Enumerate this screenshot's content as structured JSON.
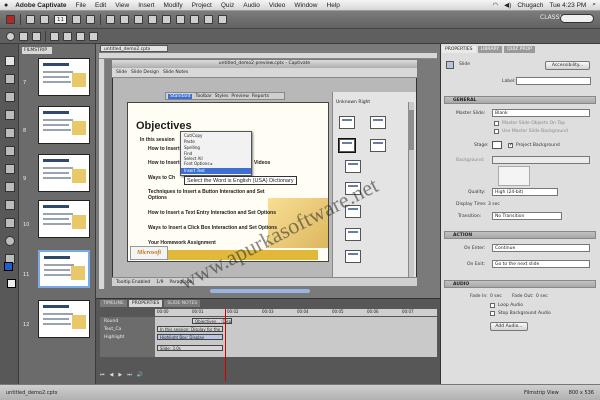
{
  "menubar": {
    "apple": "",
    "app_name": "Adobe Captivate",
    "items": [
      "File",
      "Edit",
      "View",
      "Insert",
      "Modify",
      "Project",
      "Quiz",
      "Audio",
      "Video",
      "Window",
      "Help"
    ],
    "user": "Chugach",
    "clock": "Tue 4:23 PM"
  },
  "toolbar": {
    "slide_number": "11",
    "workspace": "CLASSIC ▾"
  },
  "filmstrip": {
    "tab": "FILMSTRIP",
    "slide_numbers": [
      "7",
      "8",
      "9",
      "10",
      "11",
      "12"
    ],
    "selected_index": 4
  },
  "document": {
    "tab": "untitled_demo2.cptx",
    "inner_title": "untitled_demo2 preview.cptx - Captivate",
    "inner_toolbar": [
      "Slide",
      "Slide Design",
      "Slide Notes"
    ],
    "inner_tabs": [
      "Standard",
      "Toolbar",
      "Styles",
      "Preview",
      "Reports"
    ],
    "right_title": "Unknown Right",
    "slide": {
      "title": "Objectives",
      "lines": [
        "In this session",
        "How to Insert",
        "How to Insert",
        "Ways to Ch",
        "Techniques to Insert a Button Interaction and Set",
        "Options",
        "How to Insert a Text Entry Interaction and Set Options",
        "Ways to Insert a Click Box Interaction and Set Options",
        "Your Homework Assignment"
      ],
      "line_suffix": "Videos",
      "logo": "Microsoft"
    },
    "context_menu": [
      "Cut/Copy",
      "Paste",
      "Spelling",
      "Find",
      "Select All",
      "Font Options ▸",
      "Insert Text"
    ],
    "tooltip": "Select the Word is English (USA) Dictionary",
    "inner_status": [
      "Tooltip Enabled",
      "1/9",
      "Paragraph"
    ],
    "doc_status": [
      "Prev",
      "Next"
    ]
  },
  "watermark": "www.apurkasoftware.net",
  "timeline": {
    "tabs": [
      "TIMELINE",
      "PROPERTIES",
      "SLIDE NOTES"
    ],
    "ruler": [
      "00:00",
      "00:01",
      "00:02",
      "00:03",
      "00:04",
      "00:05",
      "00:06",
      "00:07"
    ],
    "layers": [
      "Round",
      "Text_Ca",
      "Highlight"
    ],
    "bars": [
      "Objectives... :Display for the rest of the slide",
      "In this session: Display for the rest",
      "Highlight Box: Display",
      "Slide: 3.0s"
    ],
    "controls": [
      "⏮",
      "◀",
      "▶",
      "⏭",
      "🔊"
    ]
  },
  "properties": {
    "tabs": [
      "PROPERTIES",
      "LIBRARY",
      "QUIZ PROP"
    ],
    "name_label": "Slide",
    "accessibility_btn": "Accessibility...",
    "label_label": "Label:",
    "sections": [
      "GENERAL",
      "ACTION",
      "AUDIO"
    ],
    "master_label": "Master Slide:",
    "master_value": "Blank",
    "master_opts": [
      "Master Slide Objects On Top",
      "Use Master Slide Background"
    ],
    "stage_label": "Stage:",
    "project_bg": "Project Background",
    "bg_label": "Background:",
    "quality_label": "Quality:",
    "quality_value": "High (24-bit)",
    "display_time": "Display Time: 3 sec",
    "transition_label": "Transition:",
    "transition_value": "No Transition",
    "on_enter_label": "On Enter:",
    "on_enter_value": "Continue",
    "on_exit_label": "On Exit:",
    "on_exit_value": "Go to the next slide",
    "fade_in": "Fade In:",
    "fade_in_val": "0 sec",
    "fade_out": "Fade Out:",
    "fade_out_val": "0 sec",
    "loop": "Loop Audio",
    "stop_bg": "Stop Background Audio",
    "add_audio": "Add Audio..."
  },
  "statusbar": {
    "file": "untitled_demo2.cptx",
    "view": "Filmstrip View",
    "size": "800 x 536"
  },
  "colors": {
    "accent": "#3b6fd4",
    "playhead": "#d40000",
    "fill_swatch": "#1e5fd0"
  }
}
